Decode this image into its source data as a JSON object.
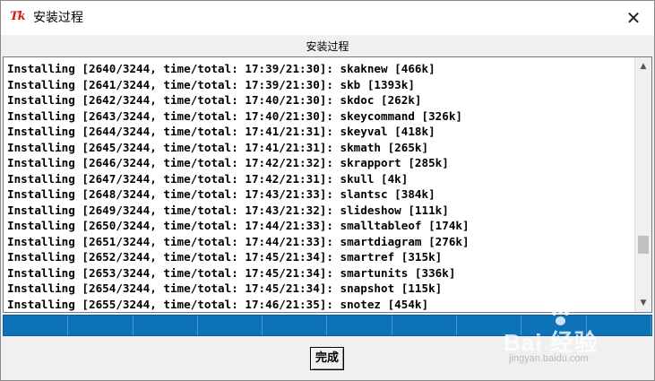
{
  "window": {
    "app_icon_text": "Tk",
    "title": "安装过程",
    "close_glyph": "✕"
  },
  "section": {
    "label": "安装过程"
  },
  "log": {
    "lines": [
      "Installing [2640/3244, time/total: 17:39/21:30]: skaknew [466k]",
      "Installing [2641/3244, time/total: 17:39/21:30]: skb [1393k]",
      "Installing [2642/3244, time/total: 17:40/21:30]: skdoc [262k]",
      "Installing [2643/3244, time/total: 17:40/21:30]: skeycommand [326k]",
      "Installing [2644/3244, time/total: 17:41/21:31]: skeyval [418k]",
      "Installing [2645/3244, time/total: 17:41/21:31]: skmath [265k]",
      "Installing [2646/3244, time/total: 17:42/21:32]: skrapport [285k]",
      "Installing [2647/3244, time/total: 17:42/21:31]: skull [4k]",
      "Installing [2648/3244, time/total: 17:43/21:33]: slantsc [384k]",
      "Installing [2649/3244, time/total: 17:43/21:32]: slideshow [111k]",
      "Installing [2650/3244, time/total: 17:44/21:33]: smalltableof [174k]",
      "Installing [2651/3244, time/total: 17:44/21:33]: smartdiagram [276k]",
      "Installing [2652/3244, time/total: 17:45/21:34]: smartref [315k]",
      "Installing [2653/3244, time/total: 17:45/21:34]: smartunits [336k]",
      "Installing [2654/3244, time/total: 17:45/21:34]: snapshot [115k]",
      "Installing [2655/3244, time/total: 17:46/21:35]: snotez [454k]"
    ],
    "scroll_up_glyph": "▲",
    "scroll_down_glyph": "▼",
    "scroll_position": 0.8
  },
  "progress": {
    "segments": 10,
    "color": "#0d72b8"
  },
  "actions": {
    "done_label": "完成"
  },
  "watermark": {
    "main": "Bai  经验",
    "sub": "jingyan.baidu.com"
  }
}
